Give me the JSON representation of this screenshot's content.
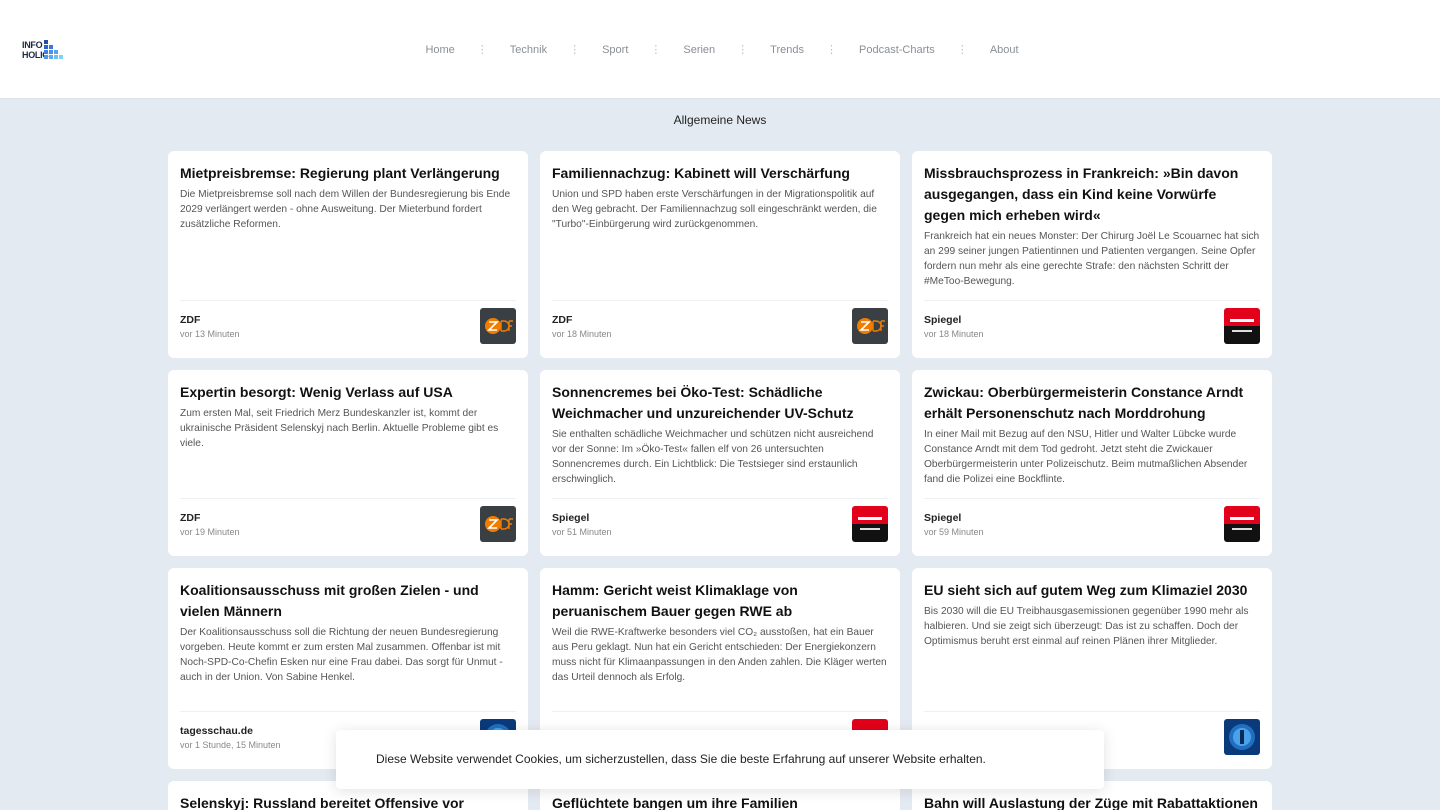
{
  "logo": {
    "line1": "INFO",
    "line2": "HOLIC"
  },
  "nav": {
    "items": [
      "Home",
      "Technik",
      "Sport",
      "Serien",
      "Trends",
      "Podcast-Charts",
      "About"
    ],
    "separator": "⋮"
  },
  "section_title": "Allgemeine News",
  "cards": [
    {
      "title": "Mietpreisbremse: Regierung plant Verlängerung",
      "desc": "Die Mietpreisbremse soll nach dem Willen der Bundesregierung bis Ende 2029 verlängert werden - ohne Ausweitung. Der Mieterbund fordert zusätzliche Reformen.",
      "source": "ZDF",
      "time": "vor 13 Minuten",
      "logo": "zdf-logo-icon"
    },
    {
      "title": "Familiennachzug: Kabinett will Verschärfung",
      "desc": "Union und SPD haben erste Verschärfungen in der Migrationspolitik auf den Weg gebracht. Der Familiennachzug soll eingeschränkt werden, die \"Turbo\"-Einbürgerung wird zurückgenommen.",
      "source": "ZDF",
      "time": "vor 18 Minuten",
      "logo": "zdf-logo-icon"
    },
    {
      "title": "Missbrauchsprozess in Frankreich: »Bin davon ausgegangen, dass ein Kind keine Vorwürfe gegen mich erheben wird«",
      "desc": "Frankreich hat ein neues Monster: Der Chirurg Joël Le Scouarnec hat sich an 299 seiner jungen Patientinnen und Patienten vergangen. Seine Opfer fordern nun mehr als eine gerechte Strafe: den nächsten Schritt der #MeToo-Bewegung.",
      "source": "Spiegel",
      "time": "vor 18 Minuten",
      "logo": "spiegel-logo-icon"
    },
    {
      "title": "Expertin besorgt: Wenig Verlass auf USA",
      "desc": "Zum ersten Mal, seit Friedrich Merz Bundeskanzler ist, kommt der ukrainische Präsident Selenskyj nach Berlin. Aktuelle Probleme gibt es viele.",
      "source": "ZDF",
      "time": "vor 19 Minuten",
      "logo": "zdf-logo-icon"
    },
    {
      "title": "Sonnencremes bei Öko-Test: Schädliche Weichmacher und unzureichender UV-Schutz",
      "desc": "Sie enthalten schädliche Weichmacher und schützen nicht ausreichend vor der Sonne: Im »Öko-Test« fallen elf von 26 untersuchten Sonnencremes durch. Ein Lichtblick: Die Testsieger sind erstaunlich erschwinglich.",
      "source": "Spiegel",
      "time": "vor 51 Minuten",
      "logo": "spiegel-logo-icon"
    },
    {
      "title": "Zwickau: Oberbürgermeisterin Constance Arndt erhält Personenschutz nach Morddrohung",
      "desc": "In einer Mail mit Bezug auf den NSU, Hitler und Walter Lübcke wurde Constance Arndt mit dem Tod gedroht. Jetzt steht die Zwickauer Oberbürgermeisterin unter Polizeischutz. Beim mutmaßlichen Absender fand die Polizei eine Bockflinte.",
      "source": "Spiegel",
      "time": "vor 59 Minuten",
      "logo": "spiegel-logo-icon"
    },
    {
      "title": "Koalitionsausschuss mit großen Zielen - und vielen Männern",
      "desc": "Der Koalitionsausschuss soll die Richtung der neuen Bundesregierung vorgeben. Heute kommt er zum ersten Mal zusammen. Offenbar ist mit Noch-SPD-Co-Chefin Esken nur eine Frau dabei. Das sorgt für Unmut - auch in der Union. Von Sabine Henkel.",
      "source": "tagesschau.de",
      "time": "vor 1 Stunde, 15 Minuten",
      "logo": "tagesschau-logo-icon"
    },
    {
      "title": "Hamm: Gericht weist Klimaklage von peruanischem Bauer gegen RWE ab",
      "desc": "Weil die RWE-Kraftwerke besonders viel CO₂ ausstoßen, hat ein Bauer aus Peru geklagt. Nun hat ein Gericht entschieden: Der Energiekonzern muss nicht für Klimaanpassungen in den Anden zahlen. Die Kläger werten das Urteil dennoch als Erfolg.",
      "source": "",
      "time": "",
      "logo": "spiegel-logo-icon"
    },
    {
      "title": "EU sieht sich auf gutem Weg zum Klimaziel 2030",
      "desc": "Bis 2030 will die EU Treibhausgasemissionen gegenüber 1990 mehr als halbieren. Und sie zeigt sich überzeugt: Das ist zu schaffen. Doch der Optimismus beruht erst einmal auf reinen Plänen ihrer Mitglieder.",
      "source": "",
      "time": "",
      "logo": "tagesschau-logo-icon"
    },
    {
      "title": "Selenskyj: Russland bereitet Offensive vor",
      "desc": "",
      "source": "",
      "time": "",
      "logo": ""
    },
    {
      "title": "Geflüchtete bangen um ihre Familien",
      "desc": "",
      "source": "",
      "time": "",
      "logo": ""
    },
    {
      "title": "Bahn will Auslastung der Züge mit Rabattaktionen",
      "desc": "",
      "source": "",
      "time": "",
      "logo": ""
    }
  ],
  "cookie_banner": {
    "text": "Diese Website verwendet Cookies, um sicherzustellen, dass Sie die beste Erfahrung auf unserer Website erhalten."
  },
  "colors": {
    "page_bg": "#e4eaf1",
    "zdf_orange": "#f07d00",
    "spiegel_red": "#e2001a",
    "tagesschau_blue": "#0a3a7a"
  }
}
